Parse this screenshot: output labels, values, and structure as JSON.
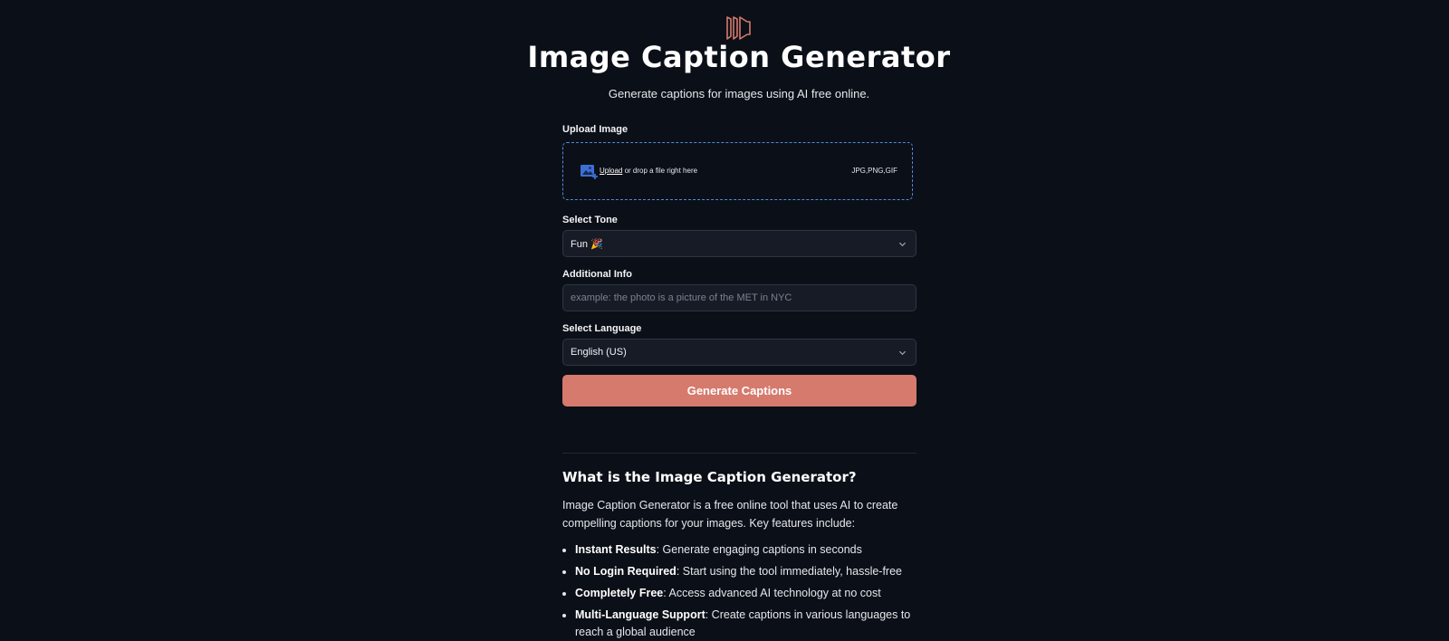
{
  "header": {
    "logo_icon": "document-brackets-icon",
    "title": "Image Caption Generator",
    "subtitle": "Generate captions for images using AI free online."
  },
  "form": {
    "upload": {
      "label": "Upload Image",
      "link_text": "Upload",
      "drop_text": " or drop a file right here",
      "file_types": "JPG,PNG,GIF",
      "icon": "image-add-icon"
    },
    "tone": {
      "label": "Select Tone",
      "selected": "Fun 🎉"
    },
    "additional_info": {
      "label": "Additional Info",
      "placeholder": "example: the photo is a picture of the MET in NYC",
      "value": ""
    },
    "language": {
      "label": "Select Language",
      "selected": "English (US)"
    },
    "submit_label": "Generate Captions"
  },
  "about": {
    "heading": "What is the Image Caption Generator?",
    "intro": "Image Caption Generator is a free online tool that uses AI to create compelling captions for your images. Key features include:",
    "features": [
      {
        "title": "Instant Results",
        "text": ": Generate engaging captions in seconds"
      },
      {
        "title": "No Login Required",
        "text": ": Start using the tool immediately, hassle-free"
      },
      {
        "title": "Completely Free",
        "text": ": Access advanced AI technology at no cost"
      },
      {
        "title": "Multi-Language Support",
        "text": ": Create captions in various languages to reach a global audience"
      }
    ]
  },
  "colors": {
    "background": "#0b0f17",
    "accent": "#d57a6d",
    "dropzone_border": "#4f8be0",
    "upload_icon": "#3b6fd6"
  }
}
